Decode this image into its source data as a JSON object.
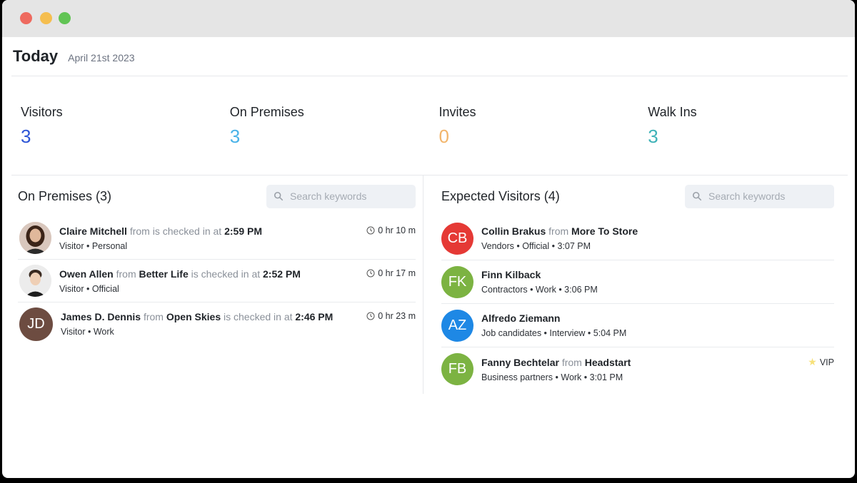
{
  "header": {
    "title": "Today",
    "date": "April 21st 2023"
  },
  "stats": [
    {
      "label": "Visitors",
      "value": "3",
      "color": "#2d55d6"
    },
    {
      "label": "On Premises",
      "value": "3",
      "color": "#4ab3e8"
    },
    {
      "label": "Invites",
      "value": "0",
      "color": "#f2b56b"
    },
    {
      "label": "Walk Ins",
      "value": "3",
      "color": "#3fb2b8"
    }
  ],
  "on_premises": {
    "title": "On Premises (3)",
    "search_placeholder": "Search keywords",
    "rows": [
      {
        "name": "Claire Mitchell",
        "from": "from",
        "company": "",
        "checked": "is checked in at",
        "time": "2:59 PM",
        "meta": "Visitor • Personal",
        "duration": "0 hr 10 m",
        "avatar": "photo-woman"
      },
      {
        "name": "Owen Allen",
        "from": "from",
        "company": "Better Life",
        "checked": "is checked in at",
        "time": "2:52 PM",
        "meta": "Visitor • Official",
        "duration": "0 hr 17 m",
        "avatar": "photo-man"
      },
      {
        "name": "James D. Dennis",
        "from": "from",
        "company": "Open Skies",
        "checked": "is checked in at",
        "time": "2:46 PM",
        "meta": "Visitor • Work",
        "duration": "0 hr 23 m",
        "avatar": "JD",
        "color": "#6d4c41"
      }
    ]
  },
  "expected": {
    "title": "Expected Visitors (4)",
    "search_placeholder": "Search keywords",
    "rows": [
      {
        "initials": "CB",
        "color": "#e53935",
        "name": "Collin Brakus",
        "from": "from",
        "company": "More To Store",
        "meta": "Vendors • Official • 3:07 PM",
        "badge": ""
      },
      {
        "initials": "FK",
        "color": "#7cb342",
        "name": "Finn Kilback",
        "from": "",
        "company": "",
        "meta": "Contractors • Work • 3:06 PM",
        "badge": ""
      },
      {
        "initials": "AZ",
        "color": "#1e88e5",
        "name": "Alfredo Ziemann",
        "from": "",
        "company": "",
        "meta": "Job candidates • Interview • 5:04 PM",
        "badge": ""
      },
      {
        "initials": "FB",
        "color": "#7cb342",
        "name": "Fanny Bechtelar",
        "from": "from",
        "company": "Headstart",
        "meta": "Business partners • Work • 3:01 PM",
        "badge": "VIP"
      }
    ]
  }
}
